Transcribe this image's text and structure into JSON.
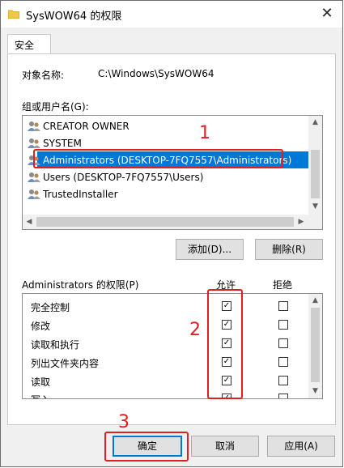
{
  "window": {
    "title": "SysWOW64 的权限",
    "close_glyph": "✕"
  },
  "tabs": [
    {
      "label": "安全"
    }
  ],
  "object": {
    "label": "对象名称:",
    "value": "C:\\Windows\\SysWOW64"
  },
  "groups": {
    "label": "组或用户名(G):",
    "items": [
      {
        "label": "CREATOR OWNER",
        "icon": "users-icon"
      },
      {
        "label": "SYSTEM",
        "icon": "users-icon"
      },
      {
        "label": "Administrators (DESKTOP-7FQ7557\\Administrators)",
        "icon": "users-icon",
        "selected": true
      },
      {
        "label": "Users (DESKTOP-7FQ7557\\Users)",
        "icon": "users-icon"
      },
      {
        "label": "TrustedInstaller",
        "icon": "users-icon"
      }
    ]
  },
  "buttons": {
    "add": "添加(D)...",
    "remove": "删除(R)",
    "ok": "确定",
    "cancel": "取消",
    "apply": "应用(A)"
  },
  "permissions": {
    "label": "Administrators 的权限(P)",
    "allow_header": "允许",
    "deny_header": "拒绝",
    "rows": [
      {
        "name": "完全控制",
        "allow": true,
        "deny": false
      },
      {
        "name": "修改",
        "allow": true,
        "deny": false
      },
      {
        "name": "读取和执行",
        "allow": true,
        "deny": false
      },
      {
        "name": "列出文件夹内容",
        "allow": true,
        "deny": false
      },
      {
        "name": "读取",
        "allow": true,
        "deny": false
      },
      {
        "name": "写入",
        "allow": true,
        "deny": false
      }
    ]
  },
  "annotations": {
    "n1": "1",
    "n2": "2",
    "n3": "3",
    "color": "#e02020"
  },
  "colors": {
    "selection": "#0078d7",
    "ok_border": "#0078d7"
  }
}
